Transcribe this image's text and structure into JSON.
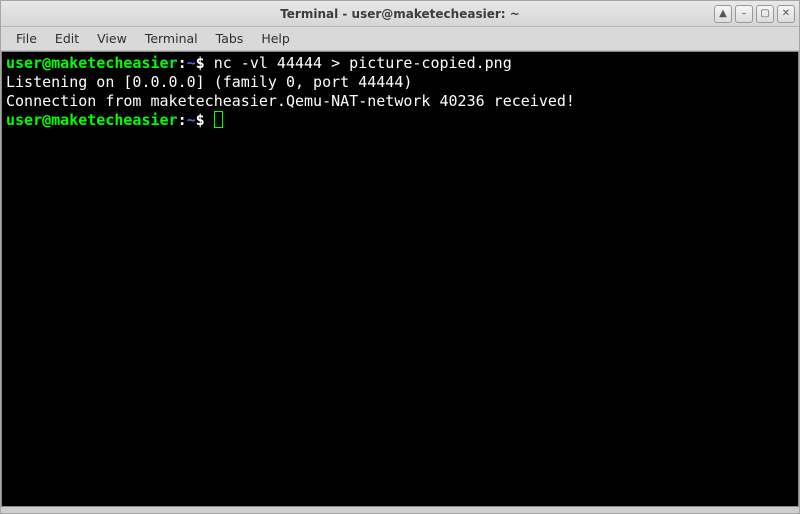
{
  "window": {
    "title": "Terminal - user@maketecheasier: ~"
  },
  "menubar": {
    "items": [
      "File",
      "Edit",
      "View",
      "Terminal",
      "Tabs",
      "Help"
    ]
  },
  "terminal": {
    "lines": [
      {
        "type": "prompt",
        "user_host": "user@maketecheasier",
        "sep": ":",
        "path": "~",
        "dollar": "$",
        "command": "nc -vl 44444 > picture-copied.png"
      },
      {
        "type": "output",
        "text": "Listening on [0.0.0.0] (family 0, port 44444)"
      },
      {
        "type": "output",
        "text": "Connection from maketecheasier.Qemu-NAT-network 40236 received!"
      },
      {
        "type": "prompt",
        "user_host": "user@maketecheasier",
        "sep": ":",
        "path": "~",
        "dollar": "$",
        "command": "",
        "cursor": true
      }
    ]
  },
  "icons": {
    "ontop": "▲",
    "minimize": "–",
    "maximize": "▢",
    "close": "✕"
  }
}
